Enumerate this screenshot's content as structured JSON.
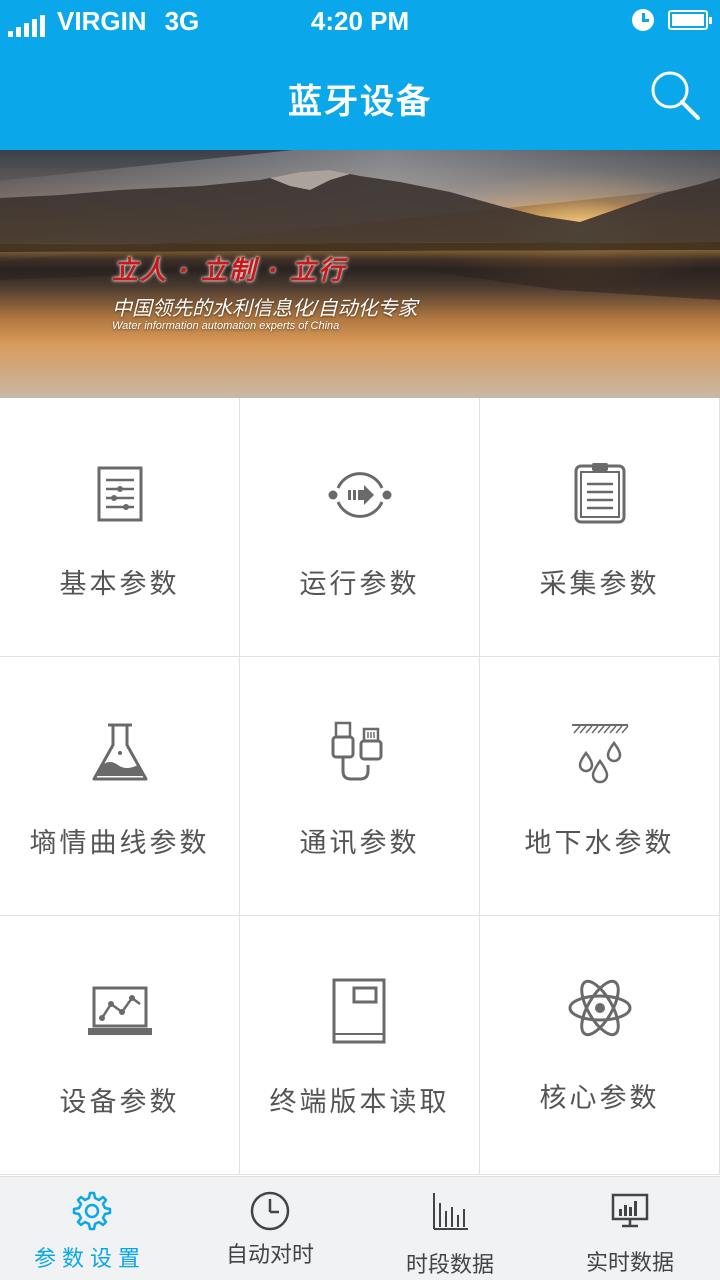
{
  "status_bar": {
    "carrier": "VIRGIN",
    "network": "3G",
    "time": "4:20 PM",
    "battery_level": 1.0,
    "icons": [
      "signal-icon",
      "alarm-clock-icon",
      "battery-icon"
    ]
  },
  "header": {
    "title": "蓝牙设备",
    "search_icon": "search-icon"
  },
  "banner": {
    "slogan": "立人 · 立制 · 立行",
    "tagline": "中国领先的水利信息化/自动化专家",
    "tagline_en": "Water information automation experts of China"
  },
  "grid": {
    "items": [
      {
        "label": "基本参数",
        "icon": "sliders-icon"
      },
      {
        "label": "运行参数",
        "icon": "cycle-arrow-icon"
      },
      {
        "label": "采集参数",
        "icon": "clipboard-icon"
      },
      {
        "label": "墒情曲线参数",
        "icon": "flask-icon"
      },
      {
        "label": "通讯参数",
        "icon": "usb-cable-icon"
      },
      {
        "label": "地下水参数",
        "icon": "water-drops-icon"
      },
      {
        "label": "设备参数",
        "icon": "laptop-chart-icon"
      },
      {
        "label": "终端版本读取",
        "icon": "device-box-icon"
      },
      {
        "label": "核心参数",
        "icon": "atom-icon"
      }
    ]
  },
  "tabbar": {
    "tabs": [
      {
        "label": "参数设置",
        "icon": "gear-icon",
        "active": true
      },
      {
        "label": "自动对时",
        "icon": "clock-icon",
        "active": false
      },
      {
        "label": "时段数据",
        "icon": "bar-chart-icon",
        "active": false
      },
      {
        "label": "实时数据",
        "icon": "monitor-chart-icon",
        "active": false
      }
    ]
  },
  "colors": {
    "accent": "#0aa7ea",
    "icon_gray": "#6a6a6a",
    "text_gray": "#555555",
    "divider": "#e2e2e2",
    "tabbar_bg": "#f0f2f3",
    "slogan_red": "#c41a1a"
  }
}
